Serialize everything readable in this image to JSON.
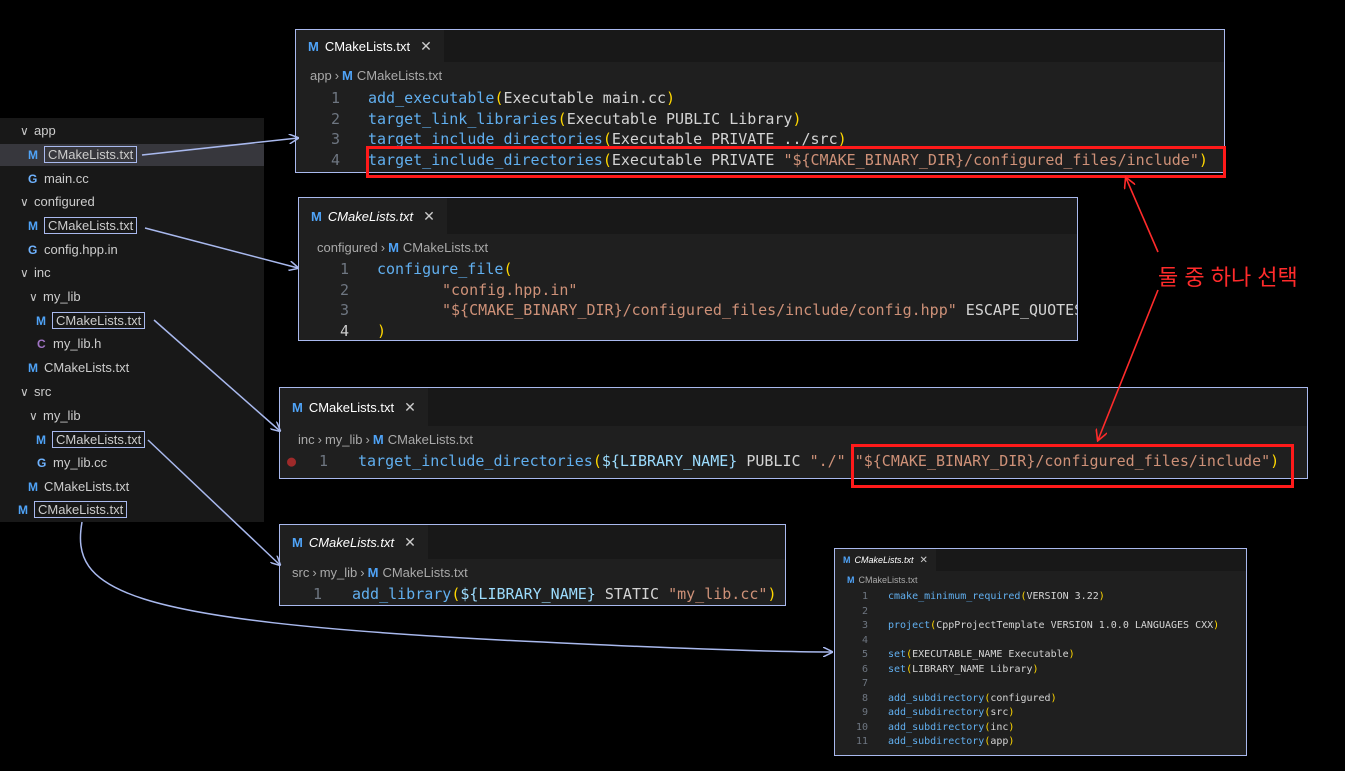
{
  "explorer": {
    "items": [
      {
        "label": "app",
        "type": "folder"
      },
      {
        "label": "CMakeLists.txt",
        "type": "cmake"
      },
      {
        "label": "main.cc",
        "type": "cpp"
      },
      {
        "label": "configured",
        "type": "folder"
      },
      {
        "label": "CMakeLists.txt",
        "type": "cmake"
      },
      {
        "label": "config.hpp.in",
        "type": "cpp"
      },
      {
        "label": "inc",
        "type": "folder"
      },
      {
        "label": "my_lib",
        "type": "folder"
      },
      {
        "label": "CMakeLists.txt",
        "type": "cmake"
      },
      {
        "label": "my_lib.h",
        "type": "c"
      },
      {
        "label": "CMakeLists.txt",
        "type": "cmake"
      },
      {
        "label": "src",
        "type": "folder"
      },
      {
        "label": "my_lib",
        "type": "folder"
      },
      {
        "label": "CMakeLists.txt",
        "type": "cmake"
      },
      {
        "label": "my_lib.cc",
        "type": "cpp"
      },
      {
        "label": "CMakeLists.txt",
        "type": "cmake"
      },
      {
        "label": "CMakeLists.txt",
        "type": "cmake"
      }
    ]
  },
  "icons": {
    "cmake": "M",
    "cpp": "G",
    "c": "C",
    "chevron": "∨",
    "close": "✕",
    "crumb_sep": "›"
  },
  "editor_app": {
    "tab": "CMakeLists.txt",
    "crumbs": [
      "app",
      "CMakeLists.txt"
    ],
    "lines": [
      {
        "n": "1",
        "fn": "add_executable",
        "args": "Executable main.cc"
      },
      {
        "n": "2",
        "fn": "target_link_libraries",
        "args": "Executable PUBLIC Library"
      },
      {
        "n": "3",
        "fn": "target_include_directories",
        "args": "Executable PRIVATE ../src"
      },
      {
        "n": "4",
        "fn": "target_include_directories",
        "args": "Executable PRIVATE ",
        "str": "\"${CMAKE_BINARY_DIR}/configured_files/include\""
      }
    ]
  },
  "editor_configured": {
    "tab": "CMakeLists.txt",
    "crumbs": [
      "configured",
      "CMakeLists.txt"
    ],
    "lines": [
      {
        "n": "1",
        "fn": "configure_file",
        "open": "("
      },
      {
        "n": "2",
        "str": "\"config.hpp.in\""
      },
      {
        "n": "3",
        "str": "\"${CMAKE_BINARY_DIR}/configured_files/include/config.hpp\"",
        "tail": " ESCAPE_QUOTES"
      },
      {
        "n": "4",
        "close": ")"
      }
    ]
  },
  "editor_inc": {
    "tab": "CMakeLists.txt",
    "crumbs": [
      "inc",
      "my_lib",
      "CMakeLists.txt"
    ],
    "line": {
      "n": "1",
      "fn": "target_include_directories",
      "var": "${LIBRARY_NAME}",
      "mid": " PUBLIC ",
      "str1": "\"./\"",
      "str2": "\"${CMAKE_BINARY_DIR}/configured_files/include\""
    }
  },
  "editor_src": {
    "tab": "CMakeLists.txt",
    "crumbs": [
      "src",
      "my_lib",
      "CMakeLists.txt"
    ],
    "line": {
      "n": "1",
      "fn": "add_library",
      "var": "${LIBRARY_NAME}",
      "mid": " STATIC ",
      "str": "\"my_lib.cc\""
    }
  },
  "editor_root": {
    "tab": "CMakeLists.txt",
    "crumbs": [
      "CMakeLists.txt"
    ],
    "lines": [
      {
        "n": "1",
        "fn": "cmake_minimum_required",
        "args": "VERSION 3.22"
      },
      {
        "n": "2"
      },
      {
        "n": "3",
        "fn": "project",
        "args": "CppProjectTemplate VERSION 1.0.0 LANGUAGES CXX"
      },
      {
        "n": "4"
      },
      {
        "n": "5",
        "fn": "set",
        "args": "EXECUTABLE_NAME Executable"
      },
      {
        "n": "6",
        "fn": "set",
        "args": "LIBRARY_NAME Library"
      },
      {
        "n": "7"
      },
      {
        "n": "8",
        "fn": "add_subdirectory",
        "args": "configured"
      },
      {
        "n": "9",
        "fn": "add_subdirectory",
        "args": "src"
      },
      {
        "n": "10",
        "fn": "add_subdirectory",
        "args": "inc"
      },
      {
        "n": "11",
        "fn": "add_subdirectory",
        "args": "app"
      }
    ]
  },
  "annotation": "둘 중 하나 선택",
  "colors": {
    "highlight_box": "#a9b9ee",
    "red_box": "#ff1a1a",
    "annotation": "#ff2b2b",
    "explorer_bg": "#181818",
    "editor_bg": "#1f1f1f"
  }
}
